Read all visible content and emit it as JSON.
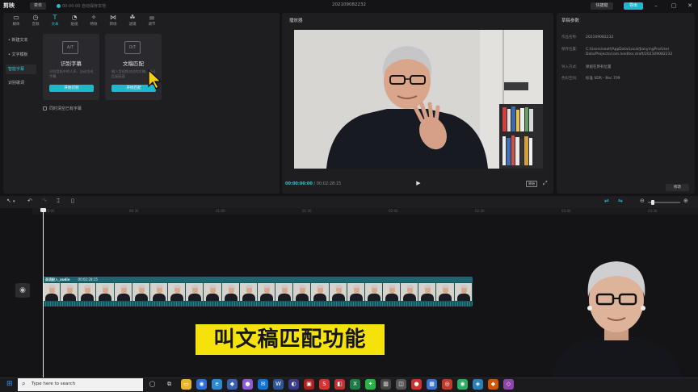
{
  "app": {
    "logo": "剪映",
    "menu_label": "菜单",
    "autosave_text": "00:00:00 自动保存本地",
    "project_title": "202109082232",
    "shortcut_label": "快捷键",
    "export_label": "导出"
  },
  "toolbar": {
    "items": [
      {
        "icon": "media-icon",
        "label": "媒体"
      },
      {
        "icon": "audio-icon",
        "label": "音频"
      },
      {
        "icon": "text-icon",
        "label": "文本"
      },
      {
        "icon": "sticker-icon",
        "label": "贴纸"
      },
      {
        "icon": "effects-icon",
        "label": "特效"
      },
      {
        "icon": "transition-icon",
        "label": "转场"
      },
      {
        "icon": "filter-icon",
        "label": "滤镜"
      },
      {
        "icon": "adjust-icon",
        "label": "调节"
      }
    ],
    "active": "文本"
  },
  "text_sidebar": {
    "items": [
      "新建文本",
      "文字模板",
      "智能字幕",
      "识别歌词"
    ],
    "active": "智能字幕"
  },
  "cards": [
    {
      "thumb": "A/T",
      "title": "识别字幕",
      "desc": "识别音轨中的人声，自动生成字幕",
      "button": "开始识别"
    },
    {
      "thumb": "O/T",
      "title": "文稿匹配",
      "desc": "输入音视频对应的文稿，自动匹配画面",
      "button": "开始匹配"
    }
  ],
  "clear_existing_label": "同时清空已有字幕",
  "player": {
    "title": "播放器",
    "time_current": "00:00:00:00",
    "time_total": "00:02:28:15",
    "ratio_label": "原始"
  },
  "draft": {
    "title": "草稿参数",
    "props": [
      {
        "k": "作品名称:",
        "v": "202109082232"
      },
      {
        "k": "保存位置:",
        "v": "C:/Users/sealf/AppData/Local/JianyingPro/User Data/Projects/com.lveditor.draft/202109082232"
      },
      {
        "k": "导入方式:",
        "v": "保留在原有位置"
      },
      {
        "k": "色彩空间:",
        "v": "标准 SDR - Rec.709"
      }
    ],
    "modify_label": "修改"
  },
  "timeline": {
    "ruler_ticks": [
      "00:00",
      "00:30",
      "01:00",
      "01:30",
      "02:00",
      "02:30",
      "03:00",
      "03:30"
    ],
    "clip_name": "英语配入_audio",
    "clip_duration": "00:02:28:15"
  },
  "caption_text": "叫文稿匹配功能",
  "taskbar": {
    "search_placeholder": "Type here to search"
  },
  "colors": {
    "accent": "#1fb8c9",
    "caption_bg": "#f5e20a",
    "clip_bg": "#17535a"
  }
}
